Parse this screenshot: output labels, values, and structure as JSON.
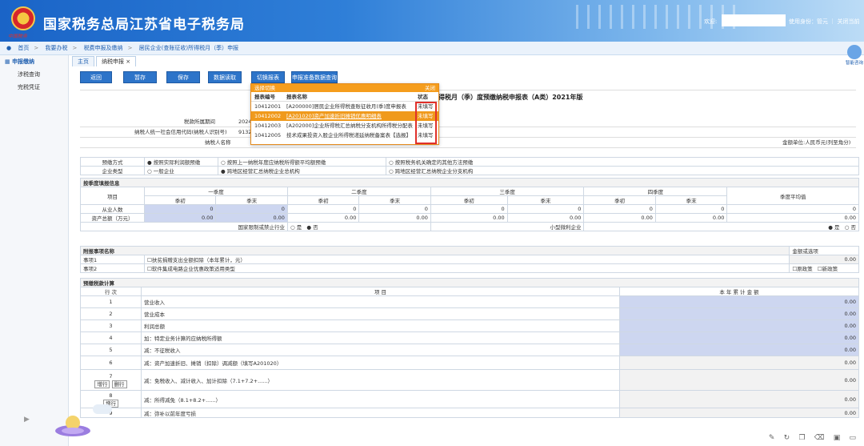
{
  "header": {
    "emblem_text": "中国税务",
    "title": "国家税务总局江苏省电子税务局",
    "welcome": "欢迎:",
    "user_info": "使用身份：管元 ｜ 关闭当前"
  },
  "breadcrumb": [
    "首页",
    "我要办税",
    "税费申报及缴纳",
    "居民企业(查账征收)所得税月（季）申报"
  ],
  "sidebar": {
    "items": [
      "申报缴纳",
      "涉税查询",
      "完税凭证"
    ]
  },
  "tabs": [
    "主页",
    "纳税申报"
  ],
  "toolbar": {
    "buttons": [
      "返回",
      "暂存",
      "保存",
      "数据读取",
      "切换报表",
      "申报准备数据查询"
    ]
  },
  "assistant_label": "智能咨询",
  "form": {
    "title": "所得税月（季）度预缴纳税申报表（A类）2021年版",
    "period_label": "税款所属期间",
    "period_value": "2024",
    "taxpayer_id_label": "纳税人统一社会信用代码(纳税人识别号)",
    "taxpayer_id_value": "9132",
    "taxpayer_name_label": "纳税人名称",
    "currency_note": "金额单位:人民币元(列至角分)",
    "method_label": "预缴方式",
    "method_options": [
      "按照实际利润额预缴",
      "按照上一纳税年度应纳税所得额平均额预缴",
      "按照税务机关确定的其他方法预缴"
    ],
    "type_label": "企业类型",
    "type_options": [
      "一般企业",
      "跨地区经营汇总纳税企业总机构",
      "跨地区经营汇总纳税企业分支机构"
    ],
    "section_quarter": "按季度填报信息",
    "item_col": "项目",
    "quarters": [
      "一季度",
      "二季度",
      "三季度",
      "四季度"
    ],
    "start": "季初",
    "end": "季末",
    "avg": "季度平均值",
    "employees_label": "从业人数",
    "employees_values": [
      "0",
      "0",
      "0",
      "0",
      "0",
      "0",
      "0",
      "0",
      "0"
    ],
    "assets_label": "资产总额（万元）",
    "assets_values": [
      "0.00",
      "0.00",
      "0.00",
      "0.00",
      "0.00",
      "0.00",
      "0.00",
      "0.00",
      "0.00"
    ],
    "restricted_label": "国家限制或禁止行业",
    "small_label": "小型微利企业",
    "yes": "是",
    "no": "否",
    "section_attached": "附报事项名称",
    "amount_or_option": "金额或选项",
    "item1_label": "事项1",
    "item1_text": "扶贫捐赠支出全额扣除（本年累计，元）",
    "item1_value": "0.00",
    "item2_label": "事项2",
    "item2_text": "软件集成电路企业优惠政策适用类型",
    "item2_opt1": "原政策",
    "item2_opt2": "新政策",
    "section_calc": "预缴税款计算",
    "row_col": "行 次",
    "project_col": "项 目",
    "ytd_col": "本 年 累 计 金 额",
    "add_row": "增行",
    "del_row": "删行",
    "rows": [
      {
        "no": "1",
        "label": "营业收入",
        "value": "0.00"
      },
      {
        "no": "2",
        "label": "营业成本",
        "value": "0.00"
      },
      {
        "no": "3",
        "label": "利润总额",
        "value": "0.00"
      },
      {
        "no": "4",
        "label": "加：特定业务计算的应纳税所得额",
        "value": "0.00"
      },
      {
        "no": "5",
        "label": "减：不征税收入",
        "value": "0.00"
      },
      {
        "no": "6",
        "label": "减：资产加速折旧、摊销（扣除）调减额（填写A201020）",
        "value": "0.00"
      },
      {
        "no": "7",
        "label": "减：免税收入、减计收入、加计扣除（7.1+7.2+......）",
        "value": "0.00"
      },
      {
        "no": "8",
        "label": "减：所得减免（8.1+8.2+......）",
        "value": "0.00"
      },
      {
        "no": "9",
        "label": "减：弥补以前年度亏损",
        "value": "0.00"
      }
    ]
  },
  "popup": {
    "title": "选择切换",
    "close": "关闭",
    "col_code": "报表编号",
    "col_name": "报表名称",
    "col_status": "状态",
    "rows": [
      {
        "code": "10412001",
        "name": "[A200000]居民企业所得税查账征收月(季)度申报表",
        "status": "未填写"
      },
      {
        "code": "10412002",
        "name": "[A201020]资产加速折旧摊销优惠明细表",
        "status": "未填写"
      },
      {
        "code": "10412003",
        "name": "[A202000]企业所得税汇总纳税分支机构所得税分配表",
        "status": "未填写"
      },
      {
        "code": "10412005",
        "name": "技术成果投资入股企业所得税递延纳税备案表【选报】",
        "status": "未填写"
      }
    ]
  }
}
